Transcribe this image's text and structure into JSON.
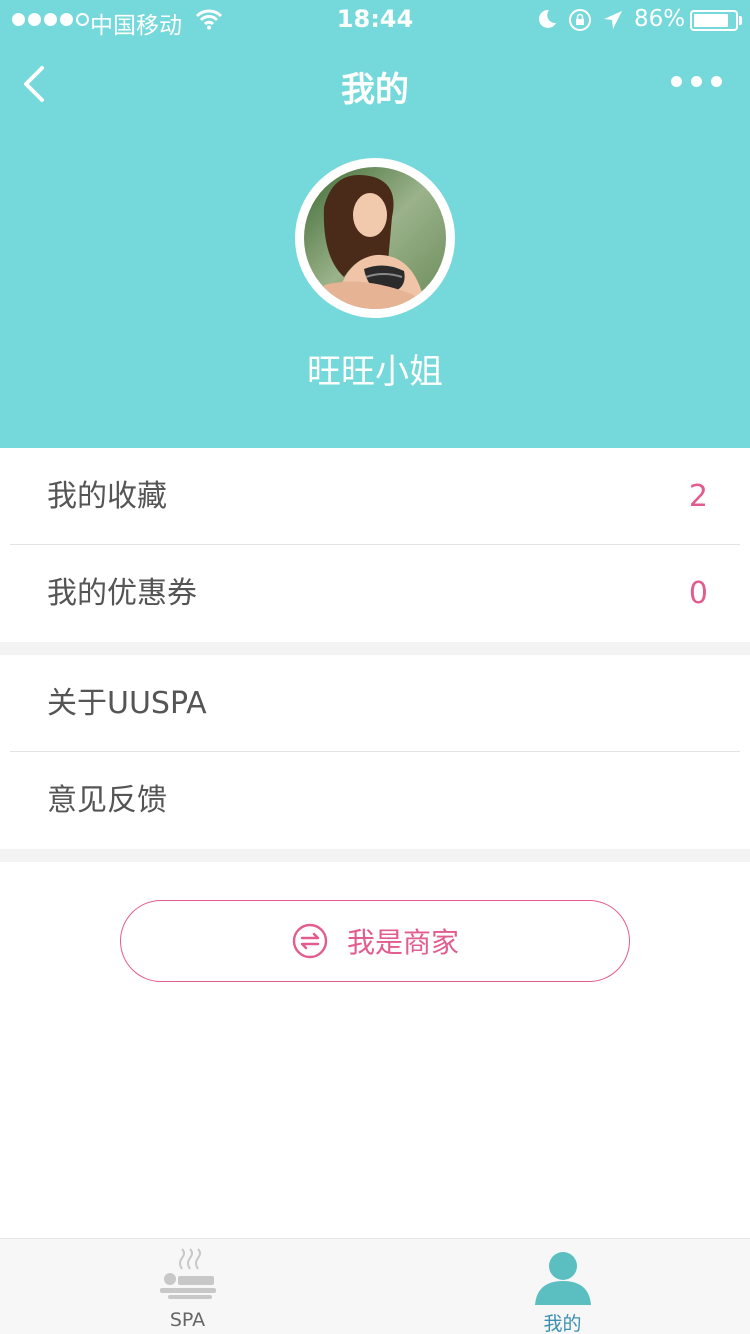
{
  "status_bar": {
    "carrier": "中国移动",
    "time": "18:44",
    "battery": "86%",
    "battery_level": 0.86
  },
  "nav": {
    "title": "我的",
    "back_icon": "chevron-left-icon",
    "more_icon": "more-dots-icon"
  },
  "profile": {
    "username": "旺旺小姐"
  },
  "menu": {
    "favorites": {
      "label": "我的收藏",
      "count": "2"
    },
    "coupons": {
      "label": "我的优惠券",
      "count": "0"
    },
    "about": {
      "label": "关于UUSPA"
    },
    "feedback": {
      "label": "意见反馈"
    }
  },
  "merchant_button": {
    "label": "我是商家",
    "icon": "switch-icon"
  },
  "tabbar": {
    "tabs": [
      {
        "label": "SPA",
        "icon": "spa-icon",
        "active": false
      },
      {
        "label": "我的",
        "icon": "user-icon",
        "active": true
      }
    ]
  },
  "colors": {
    "header_bg": "#75d8da",
    "accent": "#e25c8f",
    "active_tab": "#3f8fb4"
  }
}
